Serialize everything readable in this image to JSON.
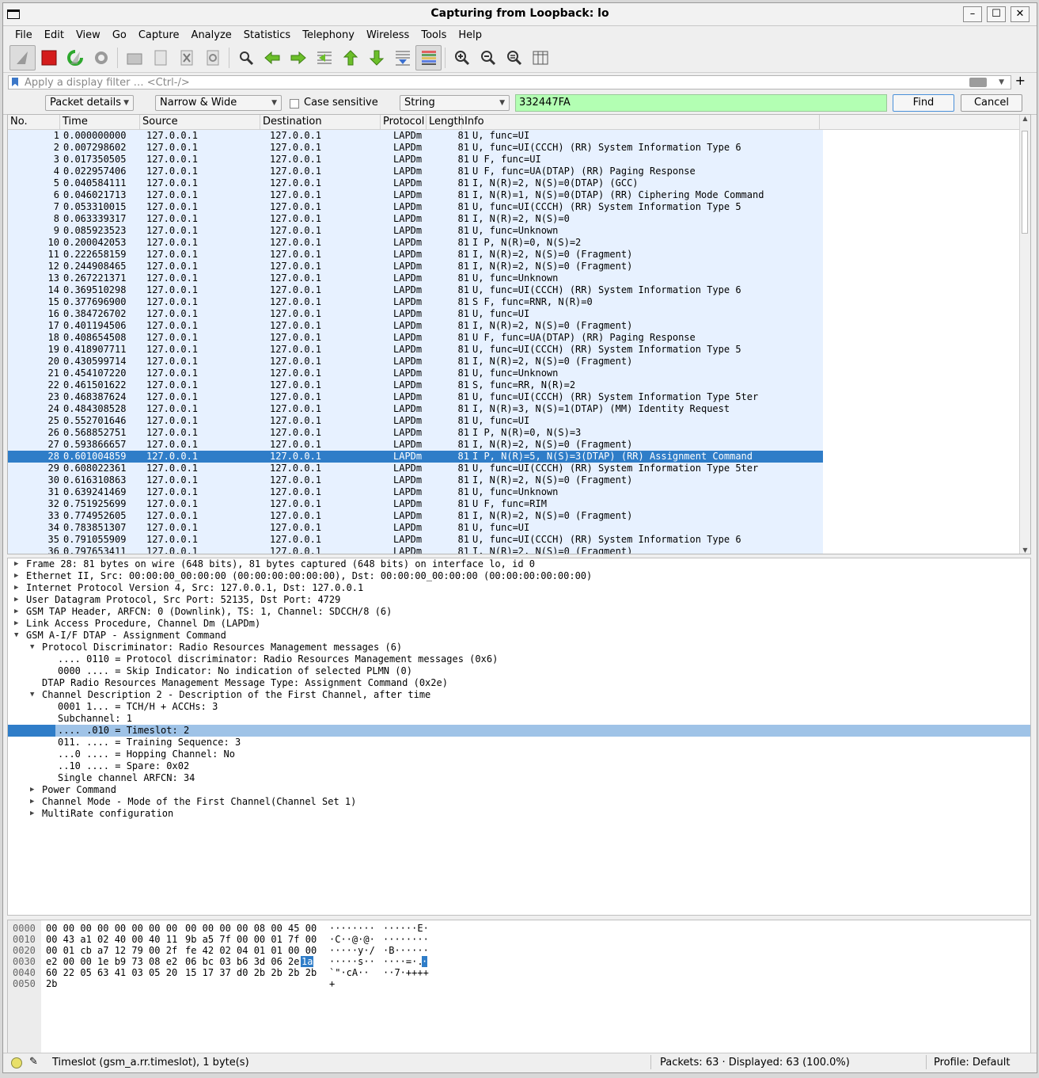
{
  "window": {
    "title": "Capturing from Loopback: lo"
  },
  "menu": [
    "File",
    "Edit",
    "View",
    "Go",
    "Capture",
    "Analyze",
    "Statistics",
    "Telephony",
    "Wireless",
    "Tools",
    "Help"
  ],
  "filter": {
    "placeholder": "Apply a display filter … <Ctrl-/>"
  },
  "find": {
    "scope": "Packet details",
    "charset": "Narrow & Wide",
    "case_label": "Case sensitive",
    "type": "String",
    "value": "332447FA",
    "find_label": "Find",
    "cancel_label": "Cancel"
  },
  "columns": [
    "No.",
    "Time",
    "Source",
    "Destination",
    "Protocol",
    "Length",
    "Info"
  ],
  "packets": [
    [
      "1",
      "0.000000000",
      "127.0.0.1",
      "127.0.0.1",
      "LAPDm",
      "81",
      "U, func=UI"
    ],
    [
      "2",
      "0.007298602",
      "127.0.0.1",
      "127.0.0.1",
      "LAPDm",
      "81",
      "U, func=UI(CCCH) (RR) System Information Type 6"
    ],
    [
      "3",
      "0.017350505",
      "127.0.0.1",
      "127.0.0.1",
      "LAPDm",
      "81",
      "U F, func=UI"
    ],
    [
      "4",
      "0.022957406",
      "127.0.0.1",
      "127.0.0.1",
      "LAPDm",
      "81",
      "U F, func=UA(DTAP) (RR) Paging Response"
    ],
    [
      "5",
      "0.040584111",
      "127.0.0.1",
      "127.0.0.1",
      "LAPDm",
      "81",
      "I, N(R)=2, N(S)=0(DTAP) (GCC)"
    ],
    [
      "6",
      "0.046021713",
      "127.0.0.1",
      "127.0.0.1",
      "LAPDm",
      "81",
      "I, N(R)=1, N(S)=0(DTAP) (RR) Ciphering Mode Command"
    ],
    [
      "7",
      "0.053310015",
      "127.0.0.1",
      "127.0.0.1",
      "LAPDm",
      "81",
      "U, func=UI(CCCH) (RR) System Information Type 5"
    ],
    [
      "8",
      "0.063339317",
      "127.0.0.1",
      "127.0.0.1",
      "LAPDm",
      "81",
      "I, N(R)=2, N(S)=0"
    ],
    [
      "9",
      "0.085923523",
      "127.0.0.1",
      "127.0.0.1",
      "LAPDm",
      "81",
      "U, func=Unknown"
    ],
    [
      "10",
      "0.200042053",
      "127.0.0.1",
      "127.0.0.1",
      "LAPDm",
      "81",
      "I P, N(R)=0, N(S)=2"
    ],
    [
      "11",
      "0.222658159",
      "127.0.0.1",
      "127.0.0.1",
      "LAPDm",
      "81",
      "I, N(R)=2, N(S)=0 (Fragment)"
    ],
    [
      "12",
      "0.244908465",
      "127.0.0.1",
      "127.0.0.1",
      "LAPDm",
      "81",
      "I, N(R)=2, N(S)=0 (Fragment)"
    ],
    [
      "13",
      "0.267221371",
      "127.0.0.1",
      "127.0.0.1",
      "LAPDm",
      "81",
      "U, func=Unknown"
    ],
    [
      "14",
      "0.369510298",
      "127.0.0.1",
      "127.0.0.1",
      "LAPDm",
      "81",
      "U, func=UI(CCCH) (RR) System Information Type 6"
    ],
    [
      "15",
      "0.377696900",
      "127.0.0.1",
      "127.0.0.1",
      "LAPDm",
      "81",
      "S F, func=RNR, N(R)=0"
    ],
    [
      "16",
      "0.384726702",
      "127.0.0.1",
      "127.0.0.1",
      "LAPDm",
      "81",
      "U, func=UI"
    ],
    [
      "17",
      "0.401194506",
      "127.0.0.1",
      "127.0.0.1",
      "LAPDm",
      "81",
      "I, N(R)=2, N(S)=0 (Fragment)"
    ],
    [
      "18",
      "0.408654508",
      "127.0.0.1",
      "127.0.0.1",
      "LAPDm",
      "81",
      "U F, func=UA(DTAP) (RR) Paging Response"
    ],
    [
      "19",
      "0.418907711",
      "127.0.0.1",
      "127.0.0.1",
      "LAPDm",
      "81",
      "U, func=UI(CCCH) (RR) System Information Type 5"
    ],
    [
      "20",
      "0.430599714",
      "127.0.0.1",
      "127.0.0.1",
      "LAPDm",
      "81",
      "I, N(R)=2, N(S)=0 (Fragment)"
    ],
    [
      "21",
      "0.454107220",
      "127.0.0.1",
      "127.0.0.1",
      "LAPDm",
      "81",
      "U, func=Unknown"
    ],
    [
      "22",
      "0.461501622",
      "127.0.0.1",
      "127.0.0.1",
      "LAPDm",
      "81",
      "S, func=RR, N(R)=2"
    ],
    [
      "23",
      "0.468387624",
      "127.0.0.1",
      "127.0.0.1",
      "LAPDm",
      "81",
      "U, func=UI(CCCH) (RR) System Information Type 5ter"
    ],
    [
      "24",
      "0.484308528",
      "127.0.0.1",
      "127.0.0.1",
      "LAPDm",
      "81",
      "I, N(R)=3, N(S)=1(DTAP) (MM) Identity Request"
    ],
    [
      "25",
      "0.552701646",
      "127.0.0.1",
      "127.0.0.1",
      "LAPDm",
      "81",
      "U, func=UI"
    ],
    [
      "26",
      "0.568852751",
      "127.0.0.1",
      "127.0.0.1",
      "LAPDm",
      "81",
      "I P, N(R)=0, N(S)=3"
    ],
    [
      "27",
      "0.593866657",
      "127.0.0.1",
      "127.0.0.1",
      "LAPDm",
      "81",
      "I, N(R)=2, N(S)=0 (Fragment)"
    ],
    [
      "28",
      "0.601004859",
      "127.0.0.1",
      "127.0.0.1",
      "LAPDm",
      "81",
      "I P, N(R)=5, N(S)=3(DTAP) (RR) Assignment Command"
    ],
    [
      "29",
      "0.608022361",
      "127.0.0.1",
      "127.0.0.1",
      "LAPDm",
      "81",
      "U, func=UI(CCCH) (RR) System Information Type 5ter"
    ],
    [
      "30",
      "0.616310863",
      "127.0.0.1",
      "127.0.0.1",
      "LAPDm",
      "81",
      "I, N(R)=2, N(S)=0 (Fragment)"
    ],
    [
      "31",
      "0.639241469",
      "127.0.0.1",
      "127.0.0.1",
      "LAPDm",
      "81",
      "U, func=Unknown"
    ],
    [
      "32",
      "0.751925699",
      "127.0.0.1",
      "127.0.0.1",
      "LAPDm",
      "81",
      "U F, func=RIM"
    ],
    [
      "33",
      "0.774952605",
      "127.0.0.1",
      "127.0.0.1",
      "LAPDm",
      "81",
      "I, N(R)=2, N(S)=0 (Fragment)"
    ],
    [
      "34",
      "0.783851307",
      "127.0.0.1",
      "127.0.0.1",
      "LAPDm",
      "81",
      "U, func=UI"
    ],
    [
      "35",
      "0.791055909",
      "127.0.0.1",
      "127.0.0.1",
      "LAPDm",
      "81",
      "U, func=UI(CCCH) (RR) System Information Type 6"
    ],
    [
      "36",
      "0.797653411",
      "127.0.0.1",
      "127.0.0.1",
      "LAPDm",
      "81",
      "I, N(R)=2, N(S)=0 (Fragment)"
    ]
  ],
  "selected_packet": "28",
  "details": [
    {
      "level": 0,
      "tw": "right",
      "text": "Frame 28: 81 bytes on wire (648 bits), 81 bytes captured (648 bits) on interface lo, id 0"
    },
    {
      "level": 0,
      "tw": "right",
      "text": "Ethernet II, Src: 00:00:00_00:00:00 (00:00:00:00:00:00), Dst: 00:00:00_00:00:00 (00:00:00:00:00:00)"
    },
    {
      "level": 0,
      "tw": "right",
      "text": "Internet Protocol Version 4, Src: 127.0.0.1, Dst: 127.0.0.1"
    },
    {
      "level": 0,
      "tw": "right",
      "text": "User Datagram Protocol, Src Port: 52135, Dst Port: 4729"
    },
    {
      "level": 0,
      "tw": "right",
      "text": "GSM TAP Header, ARFCN: 0 (Downlink), TS: 1, Channel: SDCCH/8 (6)"
    },
    {
      "level": 0,
      "tw": "right",
      "text": "Link Access Procedure, Channel Dm (LAPDm)"
    },
    {
      "level": 0,
      "tw": "down",
      "text": "GSM A-I/F DTAP - Assignment Command"
    },
    {
      "level": 1,
      "tw": "down",
      "text": "Protocol Discriminator: Radio Resources Management messages (6)"
    },
    {
      "level": 2,
      "tw": "",
      "text": ".... 0110 = Protocol discriminator: Radio Resources Management messages (0x6)"
    },
    {
      "level": 2,
      "tw": "",
      "text": "0000 .... = Skip Indicator: No indication of selected PLMN (0)"
    },
    {
      "level": 1,
      "tw": "",
      "text": "DTAP Radio Resources Management Message Type: Assignment Command (0x2e)"
    },
    {
      "level": 1,
      "tw": "down",
      "text": "Channel Description 2 - Description of the First Channel, after time"
    },
    {
      "level": 2,
      "tw": "",
      "text": "0001 1... = TCH/H + ACCHs: 3"
    },
    {
      "level": 2,
      "tw": "",
      "text": "Subchannel: 1"
    },
    {
      "level": 2,
      "tw": "",
      "text": ".... .010 = Timeslot: 2",
      "selected": true
    },
    {
      "level": 2,
      "tw": "",
      "text": "011. .... = Training Sequence: 3"
    },
    {
      "level": 2,
      "tw": "",
      "text": "...0 .... = Hopping Channel: No"
    },
    {
      "level": 2,
      "tw": "",
      "text": "..10 .... = Spare: 0x02"
    },
    {
      "level": 2,
      "tw": "",
      "text": "Single channel ARFCN: 34"
    },
    {
      "level": 1,
      "tw": "right",
      "text": "Power Command"
    },
    {
      "level": 1,
      "tw": "right",
      "text": "Channel Mode - Mode of the First Channel(Channel Set 1)"
    },
    {
      "level": 1,
      "tw": "right",
      "text": "MultiRate configuration"
    }
  ],
  "bytes": [
    {
      "off": "0000",
      "h1": "00 00 00 00 00 00 00 00",
      "h2": "00 00 00 00 08 00 45 00",
      "a1": "········",
      "a2": "······E·"
    },
    {
      "off": "0010",
      "h1": "00 43 a1 02 40 00 40 11",
      "h2": "9b a5 7f 00 00 01 7f 00",
      "a1": "·C··@·@·",
      "a2": "········"
    },
    {
      "off": "0020",
      "h1": "00 01 cb a7 12 79 00 2f",
      "h2": "fe 42 02 04 01 01 00 00",
      "a1": "·····y·/",
      "a2": "·B······"
    },
    {
      "off": "0030",
      "h1": "e2 00 00 1e b9 73 08 e2",
      "h2": "06 bc 03 b6 3d 06 2e",
      "hl": "1a",
      "a1": "·····s··",
      "a2": "····=·.",
      "ahl": "·"
    },
    {
      "off": "0040",
      "h1": "60 22 05 63 41 03 05 20",
      "h2": "15 17 37 d0 2b 2b 2b 2b",
      "a1": "`\"·cA·· ",
      "a2": "··7·++++"
    },
    {
      "off": "0050",
      "h1": "2b",
      "h2": "",
      "a1": "+",
      "a2": ""
    }
  ],
  "status": {
    "field": "Timeslot (gsm_a.rr.timeslot), 1 byte(s)",
    "packets": "Packets: 63 · Displayed: 63 (100.0%)",
    "profile": "Profile: Default"
  }
}
